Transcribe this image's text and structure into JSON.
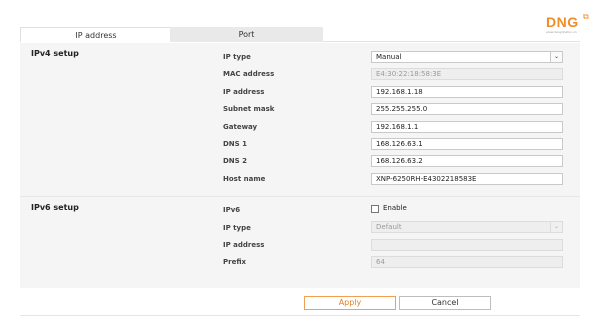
{
  "tabs": [
    {
      "label": "IP address",
      "active": true
    },
    {
      "label": "Port",
      "active": false
    }
  ],
  "logo": {
    "text": "DNG",
    "subtitle": "www.dangnhatvn.vn",
    "brand_color": "#f28c28"
  },
  "ipv4": {
    "title": "IPv4 setup",
    "ip_type": {
      "label": "IP type",
      "value": "Manual"
    },
    "mac_address": {
      "label": "MAC address",
      "value": "E4:30:22:18:58:3E"
    },
    "ip_address": {
      "label": "IP address",
      "value": "192.168.1.18"
    },
    "subnet_mask": {
      "label": "Subnet mask",
      "value": "255.255.255.0"
    },
    "gateway": {
      "label": "Gateway",
      "value": "192.168.1.1"
    },
    "dns1": {
      "label": "DNS 1",
      "value": "168.126.63.1"
    },
    "dns2": {
      "label": "DNS 2",
      "value": "168.126.63.2"
    },
    "host_name": {
      "label": "Host name",
      "value": "XNP-6250RH-E4302218583E"
    }
  },
  "ipv6": {
    "title": "IPv6 setup",
    "ipv6": {
      "label": "IPv6",
      "checkbox_label": "Enable",
      "checked": false
    },
    "ip_type": {
      "label": "IP type",
      "value": "Default"
    },
    "ip_address": {
      "label": "IP address",
      "value": ""
    },
    "prefix": {
      "label": "Prefix",
      "value": "64"
    }
  },
  "buttons": {
    "apply": "Apply",
    "cancel": "Cancel"
  },
  "colors": {
    "accent": "#e57f20",
    "panel_bg": "#f5f5f5"
  }
}
